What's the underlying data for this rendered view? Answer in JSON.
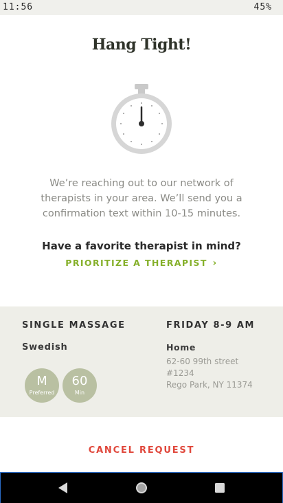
{
  "status_bar": {
    "time": "11:56",
    "battery": "45%"
  },
  "header": {
    "title": "Hang Tight!"
  },
  "icons": {
    "timer": "stopwatch-icon",
    "chevron": "chevron-right-icon"
  },
  "message": {
    "lines": [
      "We’re reaching out to our network of",
      "therapists in your area. We’ll send you a",
      "confirmation text within 10-15 minutes."
    ]
  },
  "favorite": {
    "question": "Have a favorite therapist in mind?",
    "link_label": "PRIORITIZE A THERAPIST",
    "link_chevron": "›"
  },
  "booking": {
    "service_type": "SINGLE MASSAGE",
    "service_style": "Swedish",
    "preference_badge": {
      "big": "M",
      "small": "Preferred"
    },
    "duration_badge": {
      "big": "60",
      "small": "Min"
    },
    "when": "FRIDAY 8-9 AM",
    "location_name": "Home",
    "address_lines": [
      "62-60 99th street",
      "#1234",
      "Rego Park, NY 11374"
    ]
  },
  "actions": {
    "cancel_label": "CANCEL REQUEST"
  },
  "colors": {
    "accent_green": "#85b02a",
    "cancel_red": "#e0473b",
    "badge_sage": "#b9c0a2",
    "summary_bg": "#eeeee8"
  }
}
